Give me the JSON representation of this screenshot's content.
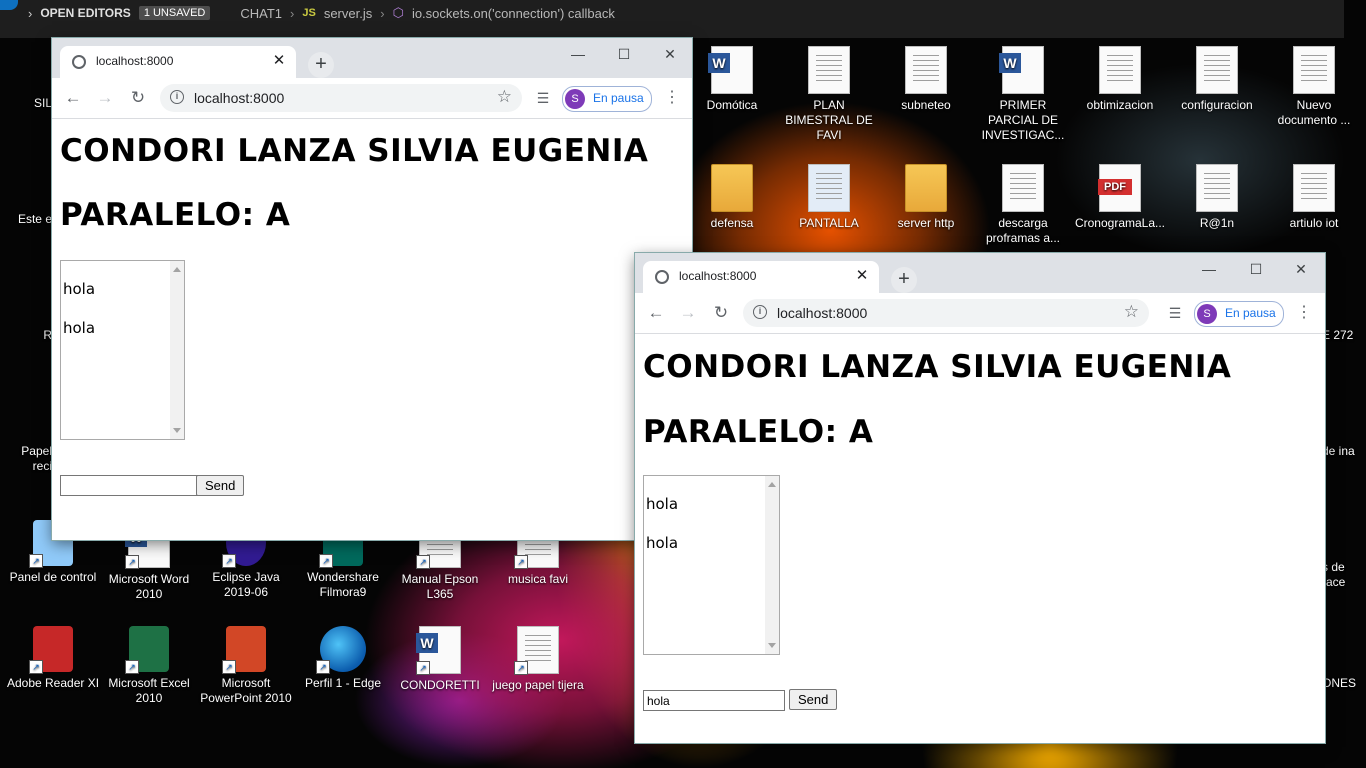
{
  "vscode": {
    "notification_count": "1",
    "open_editors": "OPEN EDITORS",
    "unsaved": "1 UNSAVED",
    "folder": "CHAT1",
    "file_icon": "JS",
    "file": "server.js",
    "symbol": "io.sockets.on('connection') callback"
  },
  "desktop": {
    "icons_row1": [
      {
        "label": "Domótica",
        "icon": "word-doc-icon"
      },
      {
        "label": "PLAN BIMESTRAL DE FAVI",
        "icon": "document-icon"
      },
      {
        "label": "subneteo",
        "icon": "document-icon"
      },
      {
        "label": "PRIMER PARCIAL DE INVESTIGAC...",
        "icon": "word-doc-icon"
      },
      {
        "label": "obtimizacion",
        "icon": "document-icon"
      },
      {
        "label": "configuracion",
        "icon": "document-icon"
      },
      {
        "label": "Nuevo documento ...",
        "icon": "document-icon"
      }
    ],
    "icons_row2": [
      {
        "label": "defensa",
        "icon": "folder-icon"
      },
      {
        "label": "PANTALLA",
        "icon": "image-file-icon"
      },
      {
        "label": "server http",
        "icon": "folder-icon"
      },
      {
        "label": "descarga proframas a...",
        "icon": "document-icon"
      },
      {
        "label": "CronogramaLa...",
        "icon": "pdf-icon"
      },
      {
        "label": "R@1n",
        "icon": "document-icon"
      },
      {
        "label": "artiulo iot",
        "icon": "document-icon"
      }
    ],
    "icons_row5": [
      {
        "label": "Panel de control",
        "icon": "control-panel-icon"
      },
      {
        "label": "Microsoft Word 2010",
        "icon": "word-app-icon"
      },
      {
        "label": "Eclipse Java 2019-06",
        "icon": "eclipse-icon"
      },
      {
        "label": "Wondershare Filmora9",
        "icon": "filmora-icon"
      },
      {
        "label": "Manual Epson L365",
        "icon": "shortcut-icon"
      },
      {
        "label": "musica favi",
        "icon": "document-icon"
      }
    ],
    "icons_row6": [
      {
        "label": "Adobe Reader XI",
        "icon": "adobe-reader-icon"
      },
      {
        "label": "Microsoft Excel 2010",
        "icon": "excel-icon"
      },
      {
        "label": "Microsoft PowerPoint 2010",
        "icon": "powerpoint-icon"
      },
      {
        "label": "Perfil 1 - Edge",
        "icon": "edge-icon"
      },
      {
        "label": "CONDORETTI",
        "icon": "word-doc-icon"
      },
      {
        "label": "juego papel tijera",
        "icon": "document-icon"
      }
    ],
    "left_partial": [
      "SIL",
      "Este e",
      "R",
      "Papel\nreci"
    ],
    "right_partial": [
      "E 272",
      "de ina",
      "s de\nrace",
      "ONES"
    ]
  },
  "window1": {
    "tab_title": "localhost:8000",
    "url": "localhost:8000",
    "profile_initial": "S",
    "profile_status": "En pausa",
    "heading_name": "CONDORI LANZA SILVIA EUGENIA",
    "heading_paralelo": "PARALELO: A",
    "messages": [
      "hola",
      "hola"
    ],
    "input_value": "",
    "send_label": "Send"
  },
  "window2": {
    "tab_title": "localhost:8000",
    "url": "localhost:8000",
    "profile_initial": "S",
    "profile_status": "En pausa",
    "heading_name": "CONDORI LANZA SILVIA EUGENIA",
    "heading_paralelo": "PARALELO: A",
    "messages": [
      "hola",
      "hola"
    ],
    "input_value": "hola",
    "send_label": "Send"
  }
}
